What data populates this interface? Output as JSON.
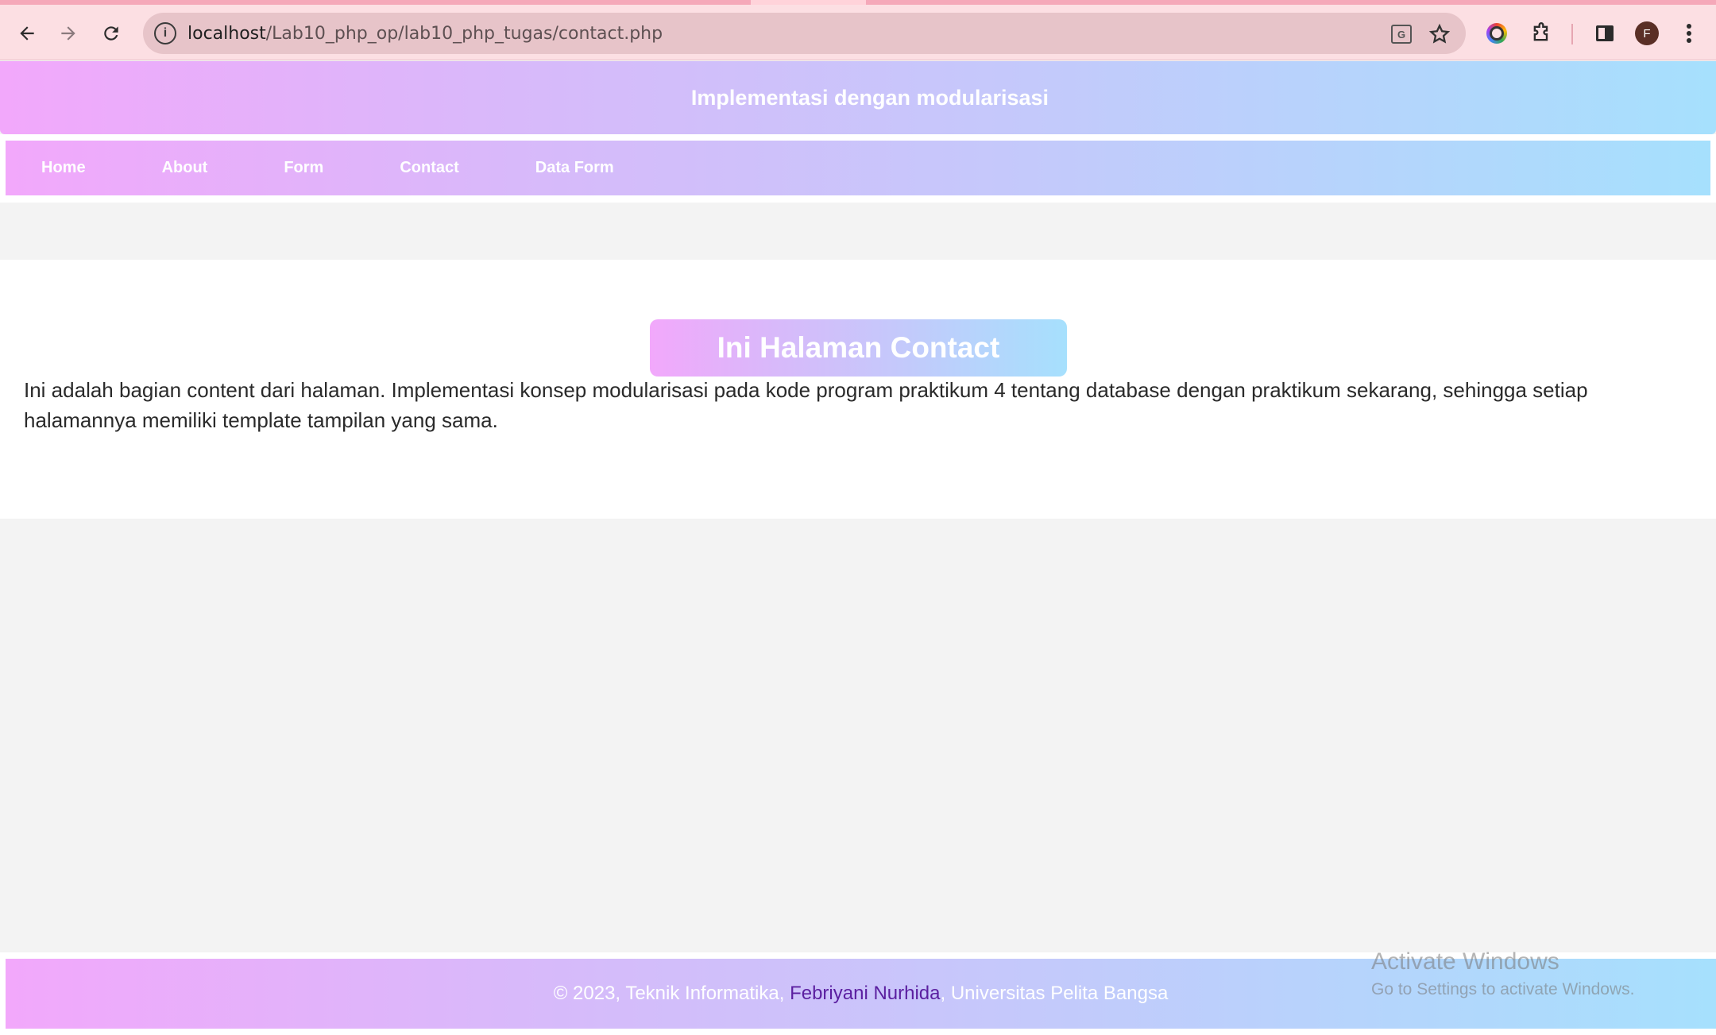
{
  "browser": {
    "url_host": "localhost",
    "url_path": "/Lab10_php_op/lab10_php_tugas/contact.php",
    "info_glyph": "i",
    "avatar_initial": "F",
    "icons": {
      "back": "arrow-left-icon",
      "forward": "arrow-right-icon",
      "reload": "reload-icon",
      "site_info": "info-icon",
      "translate": "translate-icon",
      "bookmark": "star-icon",
      "extension_color": "color-picker-extension-icon",
      "extensions": "puzzle-icon",
      "side_panel": "side-panel-icon",
      "menu": "kebab-menu-icon"
    }
  },
  "site": {
    "header_title": "Implementasi dengan modularisasi",
    "nav": [
      {
        "label": "Home"
      },
      {
        "label": "About"
      },
      {
        "label": "Form"
      },
      {
        "label": "Contact"
      },
      {
        "label": "Data Form"
      }
    ],
    "content": {
      "title": "Ini Halaman Contact",
      "body": "Ini adalah bagian content dari halaman. Implementasi konsep modularisasi pada kode program praktikum 4 tentang database dengan praktikum sekarang, sehingga setiap halamannya memiliki template tampilan yang sama."
    },
    "footer": {
      "prefix": "© 2023, Teknik Informatika, ",
      "author": "Febriyani Nurhida",
      "suffix": ", Universitas Pelita Bangsa"
    }
  },
  "os_overlay": {
    "line1": "Activate Windows",
    "line2": "Go to Settings to activate Windows."
  },
  "colors": {
    "gradient_start": "#f2a8fb",
    "gradient_end": "#a6e0fd",
    "author_link": "#5b1fa0",
    "toolbar_bg": "#fcdfe3"
  }
}
